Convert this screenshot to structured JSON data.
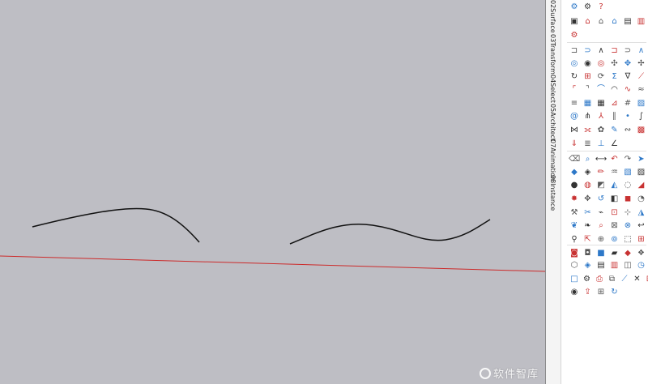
{
  "sidebar": {
    "tabs": [
      {
        "label": "02Surface"
      },
      {
        "label": "03Transform"
      },
      {
        "label": "04Select"
      },
      {
        "label": "05Architect"
      },
      {
        "label": "07Animation"
      },
      {
        "label": "08Instance"
      }
    ]
  },
  "watermark": {
    "text": "软件智库"
  },
  "colors": {
    "viewport_bg": "#bebec4",
    "axis_red": "#cc2a2a",
    "curve": "#111111",
    "icon_blue": "#2d78c8",
    "icon_red": "#c83232"
  },
  "icons": [
    {
      "name": "components-icon",
      "glyph": "⚙"
    },
    {
      "name": "materials-icon",
      "glyph": "⚙"
    },
    {
      "name": "help-icon",
      "glyph": "?"
    },
    {
      "name": "box-icon",
      "glyph": "▣"
    },
    {
      "name": "home-icon",
      "glyph": "⌂"
    },
    {
      "name": "house-outline-icon",
      "glyph": "⌂"
    },
    {
      "name": "roof-icon",
      "glyph": "⌂"
    },
    {
      "name": "window-icon",
      "glyph": "▤"
    },
    {
      "name": "stair-icon",
      "glyph": "▥"
    },
    {
      "name": "gear-plugin-icon",
      "glyph": "⚙"
    },
    {
      "name": "bracket-icon",
      "glyph": "⊐"
    },
    {
      "name": "bracket-round-icon",
      "glyph": "⊃"
    },
    {
      "name": "angle-icon",
      "glyph": "∧"
    },
    {
      "name": "bracket-2-icon",
      "glyph": "⊐"
    },
    {
      "name": "bracket-round-2-icon",
      "glyph": "⊃"
    },
    {
      "name": "angle-2-icon",
      "glyph": "∧"
    },
    {
      "name": "orbit-icon",
      "glyph": "◎"
    },
    {
      "name": "eye-icon",
      "glyph": "◉"
    },
    {
      "name": "eye-outline-icon",
      "glyph": "◎"
    },
    {
      "name": "move-icon",
      "glyph": "✣"
    },
    {
      "name": "move-2-icon",
      "glyph": "✥"
    },
    {
      "name": "arrows-icon",
      "glyph": "✢"
    },
    {
      "name": "rotate-icon",
      "glyph": "↻"
    },
    {
      "name": "extrude-icon",
      "glyph": "⊞"
    },
    {
      "name": "twist-icon",
      "glyph": "⟳"
    },
    {
      "name": "sigma-icon",
      "glyph": "Σ"
    },
    {
      "name": "nabla-icon",
      "glyph": "∇"
    },
    {
      "name": "slant-icon",
      "glyph": "⟋"
    },
    {
      "name": "corner-icon",
      "glyph": "⌜"
    },
    {
      "name": "corner-2-icon",
      "glyph": "⌝"
    },
    {
      "name": "arc-icon",
      "glyph": "⌒"
    },
    {
      "name": "arc-2-icon",
      "glyph": "◠"
    },
    {
      "name": "curve-icon",
      "glyph": "∿"
    },
    {
      "name": "wave-icon",
      "glyph": "≈"
    },
    {
      "name": "rail-icon",
      "glyph": "≡"
    },
    {
      "name": "grid-icon",
      "glyph": "▦"
    },
    {
      "name": "grid-2-icon",
      "glyph": "▦"
    },
    {
      "name": "ruler-icon",
      "glyph": "⊿"
    },
    {
      "name": "hash-icon",
      "glyph": "#"
    },
    {
      "name": "hatch-icon",
      "glyph": "▨"
    },
    {
      "name": "spiral-icon",
      "glyph": "@"
    },
    {
      "name": "branch-icon",
      "glyph": "⋔"
    },
    {
      "name": "tree-icon",
      "glyph": "⅄"
    },
    {
      "name": "bars-icon",
      "glyph": "∥"
    },
    {
      "name": "dot-icon",
      "glyph": "•"
    },
    {
      "name": "slash-icon",
      "glyph": "∫"
    },
    {
      "name": "join-icon",
      "glyph": "⋈"
    },
    {
      "name": "link-icon",
      "glyph": "⟗"
    },
    {
      "name": "gear-2-icon",
      "glyph": "✿"
    },
    {
      "name": "pen-icon",
      "glyph": "✎"
    },
    {
      "name": "snake-icon",
      "glyph": "∾"
    },
    {
      "name": "sponge-icon",
      "glyph": "▩"
    },
    {
      "name": "pin-icon",
      "glyph": "⇓"
    },
    {
      "name": "lines-icon",
      "glyph": "≣"
    },
    {
      "name": "axis-icon",
      "glyph": "⊥"
    },
    {
      "name": "angle-measure-icon",
      "glyph": "∠"
    },
    {
      "name": "eraser-icon",
      "glyph": "⌫"
    },
    {
      "name": "zoom-icon",
      "glyph": "⌕"
    },
    {
      "name": "measure-icon",
      "glyph": "⟷"
    },
    {
      "name": "undo-icon",
      "glyph": "↶"
    },
    {
      "name": "redo-icon",
      "glyph": "↷"
    },
    {
      "name": "select-icon",
      "glyph": "➤"
    },
    {
      "name": "paint-icon",
      "glyph": "◆"
    },
    {
      "name": "paint-2-icon",
      "glyph": "◈"
    },
    {
      "name": "pencil-icon",
      "glyph": "✏"
    },
    {
      "name": "freehand-icon",
      "glyph": "♒"
    },
    {
      "name": "texture-icon",
      "glyph": "▧"
    },
    {
      "name": "texture-2-icon",
      "glyph": "▨"
    },
    {
      "name": "sphere-icon",
      "glyph": "●"
    },
    {
      "name": "sphere-2-icon",
      "glyph": "◍"
    },
    {
      "name": "slice-icon",
      "glyph": "◩"
    },
    {
      "name": "cone-icon",
      "glyph": "◭"
    },
    {
      "name": "circle-cut-icon",
      "glyph": "◌"
    },
    {
      "name": "wedge-icon",
      "glyph": "◢"
    },
    {
      "name": "explode-icon",
      "glyph": "✸"
    },
    {
      "name": "move-red-icon",
      "glyph": "✥"
    },
    {
      "name": "refresh-icon",
      "glyph": "↺"
    },
    {
      "name": "shape-icon",
      "glyph": "◧"
    },
    {
      "name": "cube-icon",
      "glyph": "◼"
    },
    {
      "name": "pie-icon",
      "glyph": "◔"
    },
    {
      "name": "brush-icon",
      "glyph": "⚒"
    },
    {
      "name": "tools-icon",
      "glyph": "✂"
    },
    {
      "name": "knife-icon",
      "glyph": "⌁"
    },
    {
      "name": "frame-icon",
      "glyph": "⊡"
    },
    {
      "name": "cross-icon",
      "glyph": "⊹"
    },
    {
      "name": "tilt-icon",
      "glyph": "◮"
    },
    {
      "name": "heart-icon",
      "glyph": "❦"
    },
    {
      "name": "leaf-icon",
      "glyph": "❧"
    },
    {
      "name": "search-icon",
      "glyph": "⌕"
    },
    {
      "name": "scale-icon",
      "glyph": "⊠"
    },
    {
      "name": "no-icon",
      "glyph": "⊗"
    },
    {
      "name": "hook-icon",
      "glyph": "↩"
    },
    {
      "name": "pin-2-icon",
      "glyph": "⚲"
    },
    {
      "name": "cursor-icon",
      "glyph": "⇱"
    },
    {
      "name": "crosshair-icon",
      "glyph": "⊕"
    },
    {
      "name": "target-icon",
      "glyph": "⊚"
    },
    {
      "name": "box-3d-icon",
      "glyph": "⬚"
    },
    {
      "name": "frame-2-icon",
      "glyph": "⊞"
    },
    {
      "name": "camera-icon",
      "glyph": "◙"
    },
    {
      "name": "camera-2-icon",
      "glyph": "◘"
    },
    {
      "name": "block-icon",
      "glyph": "■"
    },
    {
      "name": "block-2-icon",
      "glyph": "▰"
    },
    {
      "name": "tile-icon",
      "glyph": "◆"
    },
    {
      "name": "tile-2-icon",
      "glyph": "❖"
    },
    {
      "name": "cube-outline-icon",
      "glyph": "⬡"
    },
    {
      "name": "scene-icon",
      "glyph": "◈"
    },
    {
      "name": "layer-icon",
      "glyph": "▤"
    },
    {
      "name": "stack-icon",
      "glyph": "▥"
    },
    {
      "name": "panel-icon",
      "glyph": "◫"
    },
    {
      "name": "clock-icon",
      "glyph": "◷"
    },
    {
      "name": "rectangle-icon",
      "glyph": "□"
    },
    {
      "name": "wrench-icon",
      "glyph": "⚙"
    },
    {
      "name": "print-icon",
      "glyph": "⎙"
    },
    {
      "name": "stack-2-icon",
      "glyph": "⧉"
    },
    {
      "name": "line-icon",
      "glyph": "⟋"
    },
    {
      "name": "close-icon",
      "glyph": "✕"
    },
    {
      "name": "grid-box-icon",
      "glyph": "⊞"
    },
    {
      "name": "disc-icon",
      "glyph": "◉"
    },
    {
      "name": "export-icon",
      "glyph": "⇪"
    },
    {
      "name": "gallery-icon",
      "glyph": "⊞"
    },
    {
      "name": "reload-icon",
      "glyph": "↻"
    }
  ]
}
